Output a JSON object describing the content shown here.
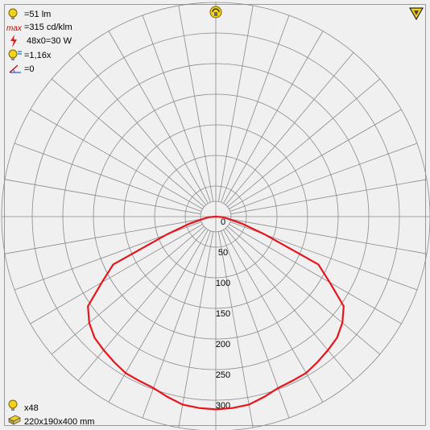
{
  "info": {
    "flux": "=51 lm",
    "max_intensity": "=315 cd/klm",
    "power": "48x0=30 W",
    "factor": "=1,16x",
    "tilt": "=0",
    "quantity": "x48",
    "dimensions": "220x190x400 mm"
  },
  "icons": {
    "lamp_color": "#f2d21a",
    "max_color": "#cc0000",
    "top_symbol": "lamp-orientation-icon",
    "corner_symbol": "warning-triangle-icon"
  },
  "chart_data": {
    "type": "polar",
    "unit": "cd/klm",
    "radial_ticks": [
      0,
      50,
      100,
      150,
      200,
      250,
      300
    ],
    "rmax": 350,
    "angle_step_deg": 10,
    "series": [
      {
        "color": "#e8141c",
        "angles": [
          -90,
          -85,
          -80,
          -75,
          -70,
          -65,
          -60,
          -55,
          -50,
          -45,
          -40,
          -35,
          -30,
          -25,
          -20,
          -15,
          -10,
          -5,
          0,
          5,
          10,
          15,
          20,
          25,
          30,
          35,
          40,
          45,
          50,
          55,
          60,
          65,
          70,
          75,
          80,
          85,
          90
        ],
        "values": [
          0,
          11,
          20,
          45,
          85,
          185,
          215,
          255,
          270,
          280,
          285,
          290,
          295,
          296,
          298,
          305,
          312,
          314,
          315,
          314,
          312,
          305,
          298,
          296,
          295,
          290,
          285,
          280,
          270,
          255,
          215,
          185,
          85,
          45,
          20,
          11,
          0
        ]
      }
    ]
  }
}
